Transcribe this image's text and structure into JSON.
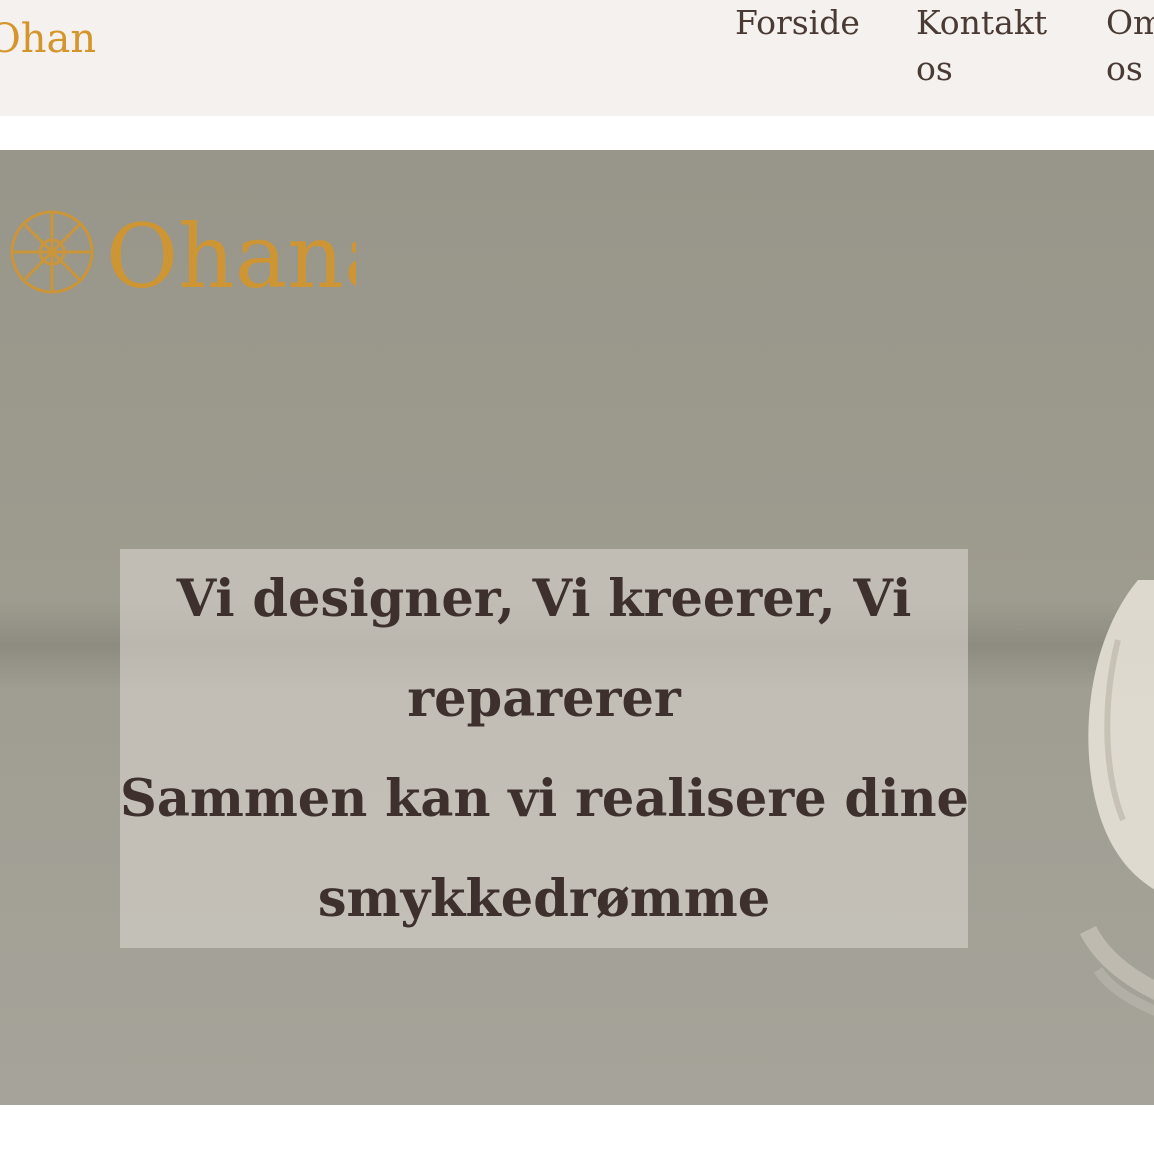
{
  "header": {
    "logo_text": "Ohana",
    "nav": {
      "forside": "Forside",
      "kontakt_os": "Kontakt os",
      "om_os": "Om os"
    }
  },
  "hero": {
    "logo_text": "Ohana",
    "headline_line_1": "Vi designer, Vi kreerer, Vi",
    "headline_line_2": "reparerer",
    "headline_line_3": "Sammen kan vi realisere dine",
    "headline_line_4": "smykkedrømme"
  },
  "colors": {
    "header_bg": "#f4f1ee",
    "nav_text": "#4a3a34",
    "logo_gold": "#d4952c",
    "hero_bg": "#9d9a8e",
    "headline_text": "#3d302d"
  },
  "icons": {
    "hero_logo_emblem": "sun-compass-emblem-icon"
  }
}
